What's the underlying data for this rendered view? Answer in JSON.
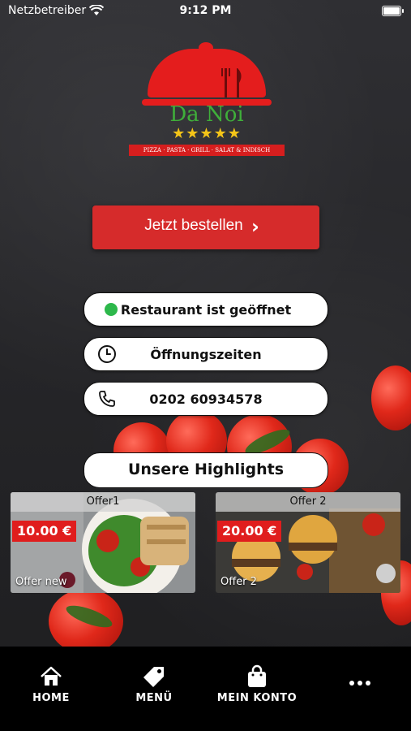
{
  "status_bar": {
    "carrier": "Netzbetreiber",
    "time": "9:12 PM"
  },
  "logo": {
    "name": "Da Noi",
    "stars": "★★★★★",
    "tagline": "PIZZA · PASTA · GRILL · SALAT & INDISCH"
  },
  "order_button": {
    "label": "Jetzt bestellen"
  },
  "info": {
    "open_status": "Restaurant ist geöffnet",
    "hours_label": "Öffnungszeiten",
    "phone": "0202 60934578"
  },
  "highlights": {
    "title": "Unsere Highlights",
    "offers": [
      {
        "title": "Offer1",
        "price": "10.00 €",
        "subtitle": "Offer new"
      },
      {
        "title": "Offer 2",
        "price": "20.00 €",
        "subtitle": "Offer 2"
      }
    ]
  },
  "tabbar": {
    "items": [
      {
        "label": "HOME",
        "icon": "home-icon"
      },
      {
        "label": "MENÜ",
        "icon": "tag-icon"
      },
      {
        "label": "MEIN KONTO",
        "icon": "shopping-bag-icon"
      },
      {
        "label": "",
        "icon": "more-icon"
      }
    ]
  },
  "colors": {
    "accent_red": "#d62b2b",
    "open_green": "#2db84b",
    "logo_green": "#3fae3a",
    "star_yellow": "#f5c518"
  }
}
